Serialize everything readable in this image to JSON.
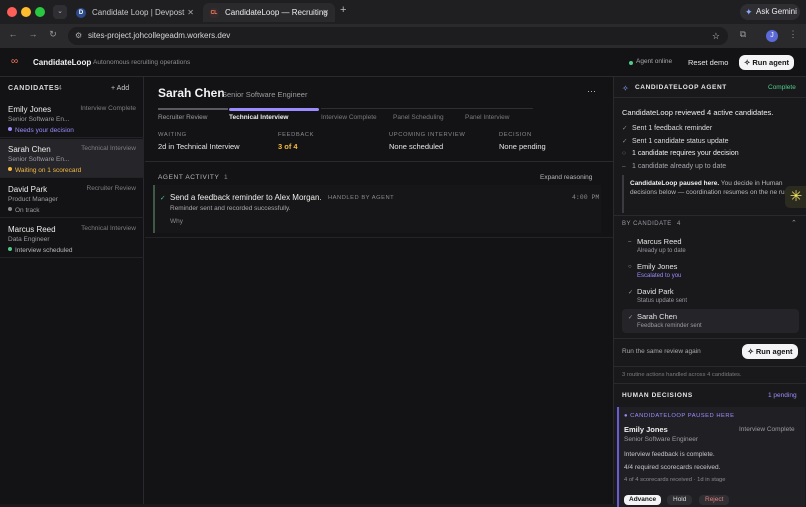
{
  "browser": {
    "tabs": [
      {
        "title": "Candidate Loop | Devpost",
        "favicon": "D"
      },
      {
        "title": "CandidateLoop — Recruiting",
        "favicon": "CL"
      }
    ],
    "url": "sites-project.johcollegeadm.workers.dev",
    "ask_gemini": "Ask Gemini",
    "profile_initial": "J"
  },
  "app": {
    "brand": "CandidateLoop",
    "tagline": "Autonomous recruiting operations",
    "agent_status": "Agent online",
    "reset_label": "Reset demo",
    "run_label": "Run agent"
  },
  "candidates": {
    "heading": "CANDIDATES",
    "count": "4",
    "add_label": "+ Add",
    "items": [
      {
        "name": "Emily Jones",
        "stage": "Interview Complete",
        "role": "Senior Software En...",
        "status": "Needs your decision",
        "status_color": "#9b8cff"
      },
      {
        "name": "Sarah Chen",
        "stage": "Technical Interview",
        "role": "Senior Software En...",
        "status": "Waiting on 1 scorecard",
        "status_color": "#f5b942"
      },
      {
        "name": "David Park",
        "stage": "Recruiter Review",
        "role": "Product Manager",
        "status": "On track",
        "status_color": "#8a8a8f"
      },
      {
        "name": "Marcus Reed",
        "stage": "Technical Interview",
        "role": "Data Engineer",
        "status": "Interview scheduled",
        "status_color": "#4ecb8a"
      }
    ]
  },
  "detail": {
    "name": "Sarah Chen",
    "role": "Senior Software Engineer",
    "more": "···",
    "pipeline": [
      "Recruiter Review",
      "Technical Interview",
      "Interview Complete",
      "Panel Scheduling",
      "Panel Interview"
    ],
    "meta": [
      {
        "key": "WAITING",
        "value": "2d in Technical Interview"
      },
      {
        "key": "FEEDBACK",
        "value": "3 of 4"
      },
      {
        "key": "UPCOMING INTERVIEW",
        "value": "None scheduled"
      },
      {
        "key": "DECISION",
        "value": "None pending"
      }
    ],
    "activity_heading": "AGENT ACTIVITY",
    "activity_count": "1",
    "expand_label": "Expand reasoning",
    "activity": {
      "check": "✓",
      "title": "Send a feedback reminder to Alex Morgan.",
      "badge": "HANDLED BY AGENT",
      "time": "4:00 PM",
      "sub": "Reminder sent and recorded successfully.",
      "why": "Why"
    }
  },
  "agent_panel": {
    "title": "CANDIDATELOOP AGENT",
    "status": "Complete",
    "summary": "CandidateLoop reviewed 4 active candidates.",
    "lines": [
      {
        "icon": "✓",
        "text": "Sent 1 feedback reminder"
      },
      {
        "icon": "✓",
        "text": "Sent 1 candidate status update"
      },
      {
        "icon": "○",
        "text": "1 candidate requires your decision"
      },
      {
        "icon": "–",
        "text": "1 candidate already up to date"
      }
    ],
    "paused_bold": "CandidateLoop paused here.",
    "paused_rest": " You decide in Human decisions below — coordination resumes on the ne run.",
    "by_candidate": "BY CANDIDATE",
    "by_count": "4",
    "by_items": [
      {
        "icon": "–",
        "name": "Marcus Reed",
        "sub": "Already up to date",
        "sub_color": "#9a9aa0"
      },
      {
        "icon": "○",
        "name": "Emily Jones",
        "sub": "Escalated to you",
        "sub_color": "#9b8cff"
      },
      {
        "icon": "✓",
        "name": "David Park",
        "sub": "Status update sent",
        "sub_color": "#9a9aa0"
      },
      {
        "icon": "✓",
        "name": "Sarah Chen",
        "sub": "Feedback reminder sent",
        "sub_color": "#9a9aa0"
      }
    ],
    "rerun_text": "Run the same review again",
    "rerun_label": "Run agent",
    "routine": "3 routine actions handled across 4 candidates.",
    "human_title": "HUMAN DECISIONS",
    "human_pending": "1 pending",
    "paused_here": "CANDIDATELOOP PAUSED HERE",
    "decision": {
      "name": "Emily Jones",
      "role": "Senior Software Engineer",
      "stage": "Interview Complete",
      "line1": "Interview feedback is complete.",
      "line2": "4/4 required scorecards received.",
      "line3": "4 of 4 scorecards received · 1d in stage",
      "actions": [
        "Advance",
        "Hold",
        "Reject"
      ]
    }
  }
}
